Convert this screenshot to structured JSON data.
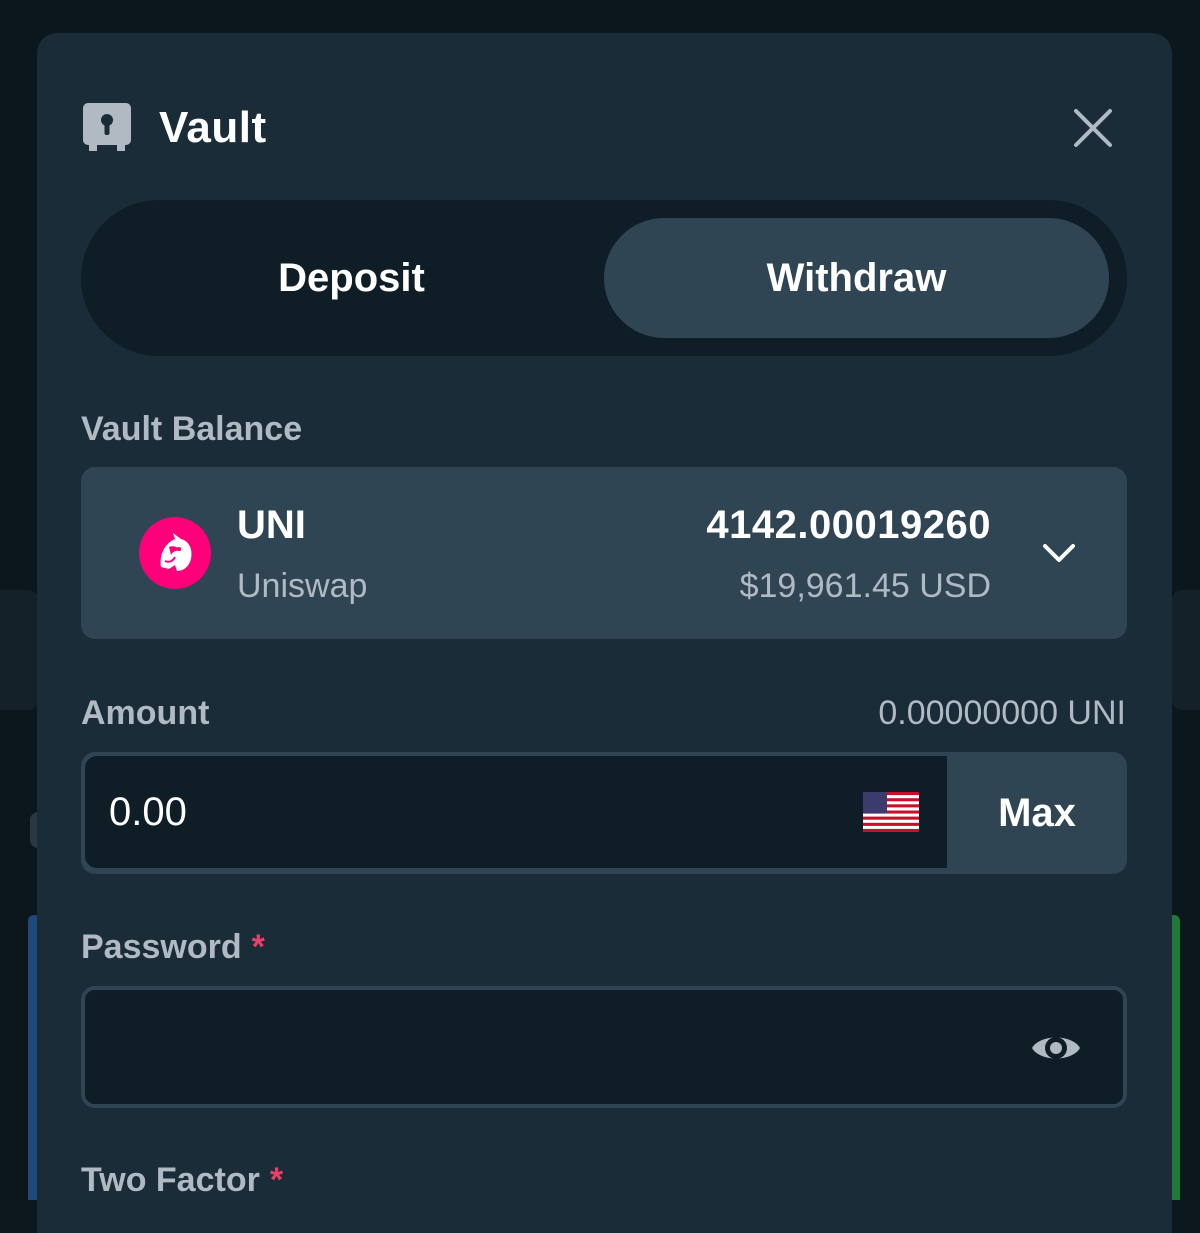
{
  "modal": {
    "title": "Vault",
    "icons": {
      "title": "vault-icon",
      "close": "close-icon"
    }
  },
  "tabs": [
    {
      "label": "Deposit",
      "active": false
    },
    {
      "label": "Withdraw",
      "active": true
    }
  ],
  "vault_balance": {
    "label": "Vault Balance",
    "asset": {
      "symbol": "UNI",
      "name": "Uniswap",
      "amount": "4142.00019260",
      "usd_value": "$19,961.45 USD",
      "icon": "uniswap-icon",
      "icon_color": "#ff007a"
    }
  },
  "amount": {
    "label": "Amount",
    "converted": "0.00000000 UNI",
    "value": "0.00",
    "currency_icon": "us-flag-icon",
    "max_label": "Max"
  },
  "password": {
    "label": "Password",
    "required_mark": "*",
    "value": ""
  },
  "two_factor": {
    "label": "Two Factor",
    "required_mark": "*"
  },
  "colors": {
    "modal_bg": "#1a2c37",
    "input_bg": "#0f1d26",
    "active_tab": "#2f4553",
    "required": "#e9416a",
    "muted_text": "#b1bac3"
  }
}
